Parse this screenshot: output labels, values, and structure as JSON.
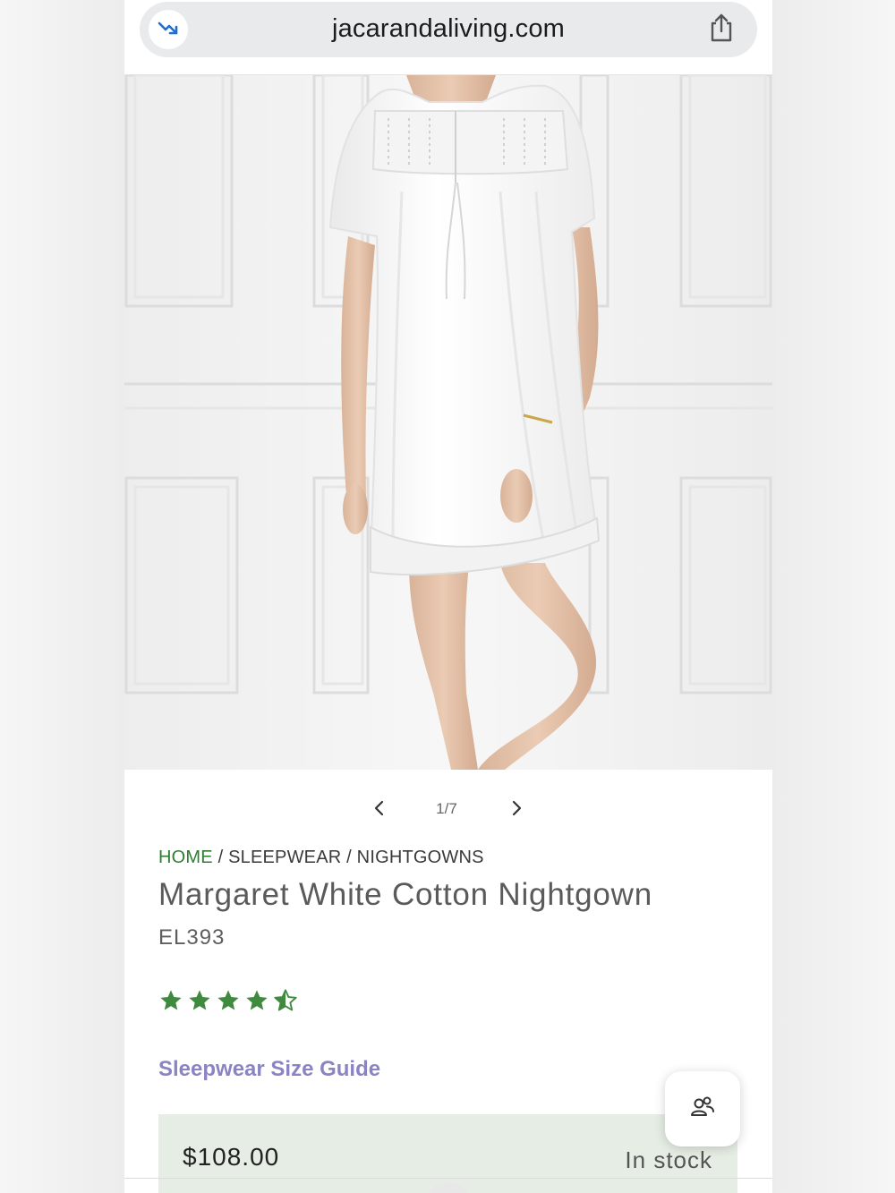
{
  "browser": {
    "url": "jacarandaliving.com"
  },
  "hero": {
    "image_alt": "Woman wearing white short-sleeved cotton nightgown with lace trim"
  },
  "carousel": {
    "counter": "1/7"
  },
  "breadcrumb": {
    "home": "HOME",
    "sep1": " / ",
    "level1": "SLEEPWEAR",
    "sep2": " / ",
    "level2": "NIGHTGOWNS"
  },
  "product": {
    "title": "Margaret White Cotton Nightgown",
    "sku": "EL393",
    "rating": 4.5,
    "rating_max": 5,
    "size_guide_label": "Sleepwear Size Guide",
    "price": "$108.00",
    "stock_status": "In stock"
  },
  "colors": {
    "star": "#3f8a3f",
    "breadcrumb_home": "#2e7d32",
    "size_guide": "#8a84c4",
    "price_box_bg": "#e5ede4"
  }
}
